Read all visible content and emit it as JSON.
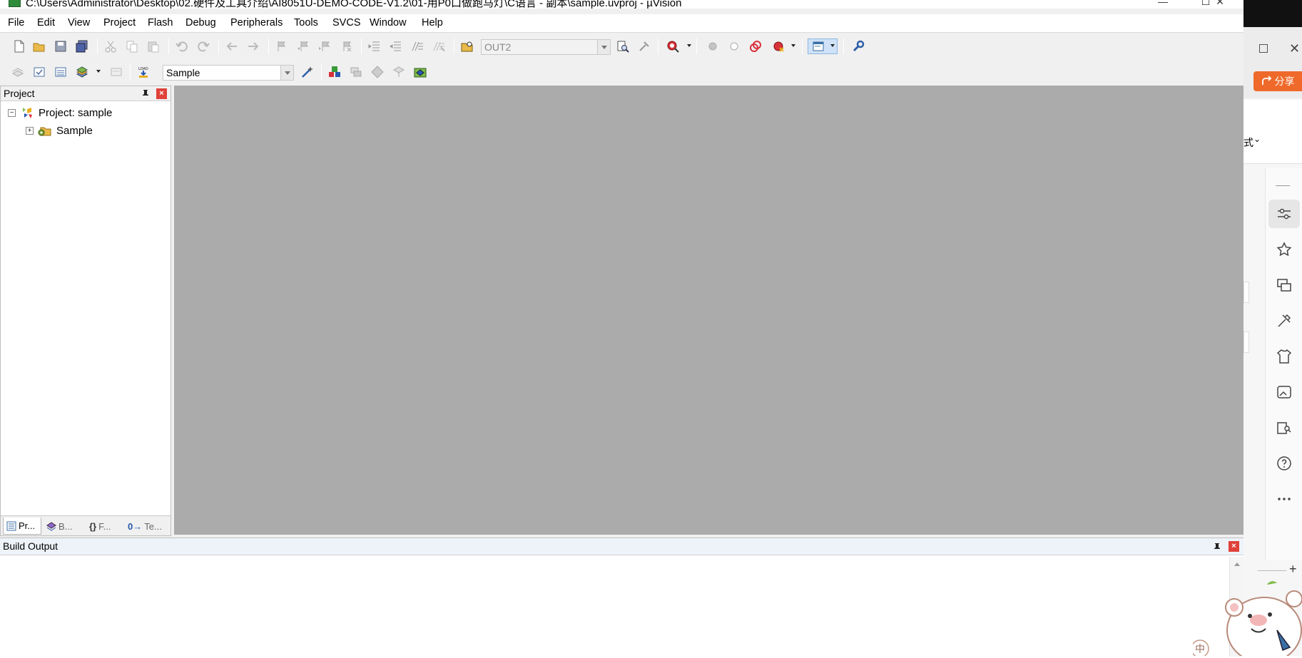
{
  "window": {
    "title": "C:\\Users\\Administrator\\Desktop\\02.硬件及工具介绍\\AI8051U-DEMO-CODE-V1.2\\01-用P0口做跑马灯\\C语言 - 副本\\sample.uvproj - µVision",
    "minimize_glyph": "—",
    "maximize_glyph": "☐",
    "close_glyph": "✕"
  },
  "menu": {
    "file": "File",
    "edit": "Edit",
    "view": "View",
    "project": "Project",
    "flash": "Flash",
    "debug": "Debug",
    "peripherals": "Peripherals",
    "tools": "Tools",
    "svcs": "SVCS",
    "window": "Window",
    "help": "Help"
  },
  "toolbar": {
    "find_combo_value": "OUT2",
    "target_combo_value": "Sample"
  },
  "project_panel": {
    "title": "Project",
    "pin_glyph": "📌",
    "close_glyph": "×",
    "tree": {
      "root_label": "Project: sample",
      "root_expander": "−",
      "group_label": "Sample",
      "group_expander": "+"
    },
    "tabs": [
      {
        "label": "Pr...",
        "icon": "project-icon",
        "active": true
      },
      {
        "label": "B...",
        "icon": "books-icon",
        "active": false
      },
      {
        "label": "F...",
        "icon": "functions-icon",
        "glyph": "{}",
        "active": false
      },
      {
        "label": "Te...",
        "icon": "templates-icon",
        "glyph": "0→",
        "active": false
      }
    ]
  },
  "build_output": {
    "title": "Build Output",
    "pin_glyph": "📌",
    "close_glyph": "×"
  },
  "side_app": {
    "share_label": "分享",
    "card_text": "式",
    "card_chevron": "⌄",
    "input_glyph": "中",
    "add_glyph": "+"
  },
  "colors": {
    "editor_bg": "#ababab",
    "close_red": "#e0413a",
    "share_orange": "#ef6a2a",
    "toolbar_bg": "#f0f0f0"
  }
}
